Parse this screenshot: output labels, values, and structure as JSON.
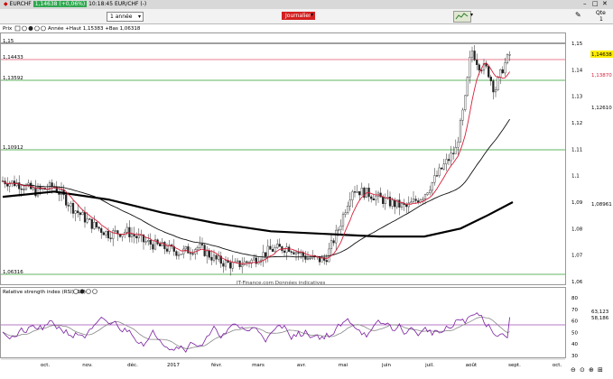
{
  "window": {
    "symbol": "EURCHF",
    "price_badge": "1,14638 (+0,06%)",
    "time_title": "10:18:45 EUR/CHF (-)"
  },
  "toolbar": {
    "period": "1 année",
    "journal_label": "Journalier",
    "qte_label": "Qte",
    "qte_value": "1"
  },
  "legend": {
    "prix_label": "Prix",
    "summary": "Année +Haut 1,15383 +Bas 1,06318",
    "source": "IT-Finance.com Données indicatives",
    "rsi_title": "Relative strength index (RSI) (14)"
  },
  "price_axis": {
    "ticks": [
      "1,15",
      "1,14",
      "1,13",
      "1,12",
      "1,11",
      "1,1",
      "1,09",
      "1,08",
      "1,07",
      "1,06"
    ],
    "tick_values": [
      1.15,
      1.14,
      1.13,
      1.12,
      1.11,
      1.1,
      1.09,
      1.08,
      1.07,
      1.06
    ],
    "last_price_tag": "1,14638",
    "ma_tag_1": "1,13870",
    "ma_tag_2": "1,12610",
    "ma_tag_3": "1,08961",
    "price_label_top": "1,15",
    "price_label_pink": "1,14433",
    "price_label_green1": "1,13592",
    "price_label_green2": "1,10912",
    "price_label_bottom": "1,06316"
  },
  "rsi_axis": {
    "ticks": [
      "80",
      "70",
      "60",
      "50",
      "40",
      "30"
    ],
    "tag_1": "63,123",
    "tag_2": "58,186"
  },
  "time_axis": {
    "labels": [
      "oct.",
      "nov.",
      "déc.",
      "2017",
      "févr.",
      "mars",
      "avr.",
      "mai",
      "juin",
      "juil.",
      "août",
      "sept.",
      "oct."
    ]
  },
  "colors": {
    "price_line_pink": "#e0506a",
    "level_green": "#2e9e2e",
    "ma_fast": "#d6203a",
    "ma_mid": "#000000",
    "ma_slow": "#000000",
    "rsi_line": "#7a1fa0",
    "rsi_signal": "#888888",
    "last_tag_bg": "#ffee00"
  },
  "chart_data": {
    "type": "line",
    "title": "EURCHF",
    "period": "1 année",
    "interval": "Journalier",
    "ylim": [
      1.06,
      1.155
    ],
    "horizontal_levels": [
      1.15,
      1.14433,
      1.13592,
      1.10912,
      1.06316
    ],
    "series": [
      {
        "name": "Prix",
        "x": [
          "oct.",
          "nov.",
          "déc.",
          "2017",
          "févr.",
          "mars",
          "avr.",
          "mai",
          "juin",
          "juil.",
          "août",
          "sept."
        ],
        "values": [
          1.095,
          1.085,
          1.078,
          1.072,
          1.067,
          1.066,
          1.069,
          1.068,
          1.093,
          1.088,
          1.148,
          1.146
        ]
      }
    ],
    "rsi": {
      "period": 14,
      "last": 63.123,
      "signal": 58.186,
      "ylim": [
        30,
        80
      ]
    }
  }
}
